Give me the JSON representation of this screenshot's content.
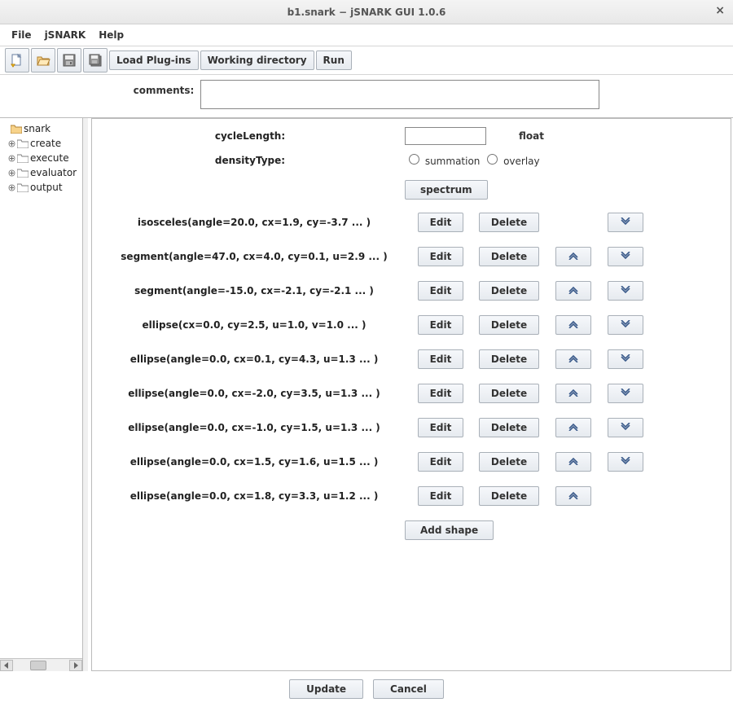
{
  "window": {
    "title": "b1.snark − jSNARK GUI 1.0.6"
  },
  "menu": {
    "items": [
      "File",
      "jSNARK",
      "Help"
    ]
  },
  "toolbar": {
    "buttons": {
      "load_plugins": "Load Plug-ins",
      "working_dir": "Working directory",
      "run": "Run"
    }
  },
  "comments": {
    "label": "comments:",
    "value": ""
  },
  "tree": {
    "root": "snark",
    "children": [
      "create",
      "execute",
      "evaluator",
      "output"
    ]
  },
  "form": {
    "cycleLength": {
      "label": "cycleLength:",
      "value": "",
      "hint": "float"
    },
    "densityType": {
      "label": "densityType:",
      "options": [
        "summation",
        "overlay"
      ],
      "selected": null
    },
    "spectrum_button": "spectrum",
    "add_shape_button": "Add shape"
  },
  "shapes": [
    {
      "label": "isosceles(angle=20.0, cx=1.9, cy=-3.7 ... )",
      "has_up": false,
      "has_down": true
    },
    {
      "label": "segment(angle=47.0, cx=4.0, cy=0.1, u=2.9 ... )",
      "has_up": true,
      "has_down": true
    },
    {
      "label": "segment(angle=-15.0, cx=-2.1, cy=-2.1 ... )",
      "has_up": true,
      "has_down": true
    },
    {
      "label": "ellipse(cx=0.0, cy=2.5, u=1.0, v=1.0 ... )",
      "has_up": true,
      "has_down": true
    },
    {
      "label": "ellipse(angle=0.0, cx=0.1, cy=4.3, u=1.3 ... )",
      "has_up": true,
      "has_down": true
    },
    {
      "label": "ellipse(angle=0.0, cx=-2.0, cy=3.5, u=1.3 ... )",
      "has_up": true,
      "has_down": true
    },
    {
      "label": "ellipse(angle=0.0, cx=-1.0, cy=1.5, u=1.3 ... )",
      "has_up": true,
      "has_down": true
    },
    {
      "label": "ellipse(angle=0.0, cx=1.5, cy=1.6, u=1.5 ... )",
      "has_up": true,
      "has_down": true
    },
    {
      "label": "ellipse(angle=0.0, cx=1.8, cy=3.3, u=1.2 ... )",
      "has_up": true,
      "has_down": false
    }
  ],
  "row_buttons": {
    "edit": "Edit",
    "delete": "Delete"
  },
  "footer": {
    "update": "Update",
    "cancel": "Cancel"
  }
}
